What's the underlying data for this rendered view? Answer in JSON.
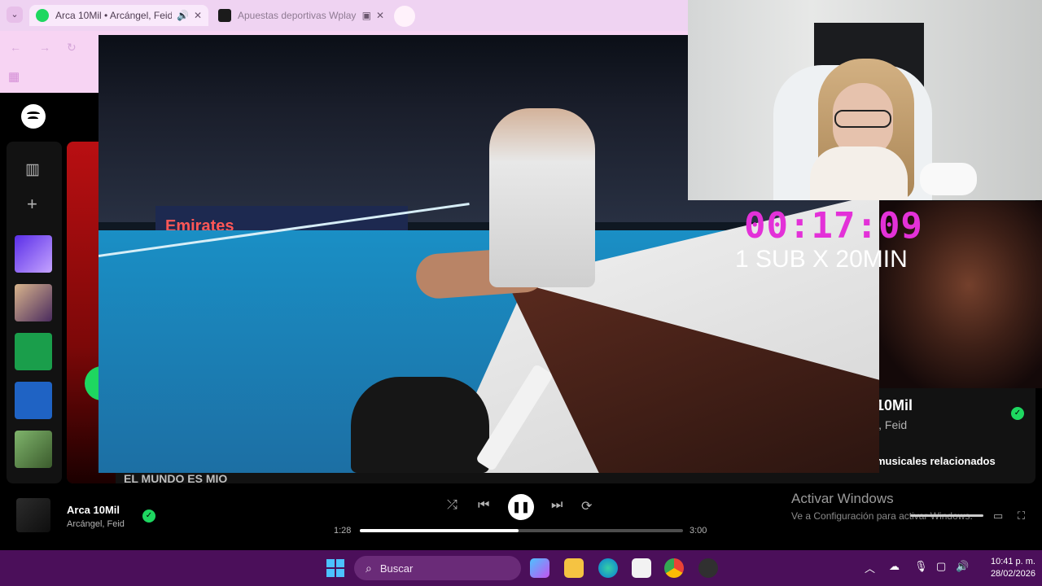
{
  "browser": {
    "tabs": [
      {
        "label": "Arca 10Mil • Arcángel, Feid",
        "audio_icon": "speaker-icon",
        "close": "✕"
      },
      {
        "label": "Apuestas deportivas Wplay",
        "pip_icon": "picture-in-picture-icon",
        "close": "✕"
      }
    ],
    "nav": {
      "back": "←",
      "forward": "→",
      "reload": "↻"
    }
  },
  "spotify": {
    "section_heading": "EL MUNDO ES MIO",
    "right_panel": {
      "title": "10Mil",
      "artist": "l, Feid",
      "related": "musicales relacionados"
    },
    "now_playing": {
      "title": "Arca 10Mil",
      "artist": "Arcángel, Feid",
      "elapsed": "1:28",
      "duration": "3:00",
      "progress": 0.49
    },
    "controls": {
      "shuffle": "⤮",
      "prev": "⏮",
      "pause": "❚❚",
      "next": "⏭",
      "repeat": "⟳"
    }
  },
  "overlay": {
    "timer": "00:17:09",
    "promo": "1 SUB X 20MIN",
    "sponsor": "Emirates"
  },
  "windows_notice": {
    "title": "Activar Windows",
    "subtitle": "Ve a Configuración para activar Windows."
  },
  "taskbar": {
    "search_placeholder": "Buscar",
    "time": "10:41 p. m.",
    "date": "28/02/2026"
  },
  "colors": {
    "spotify_green": "#1ed760",
    "timer_magenta": "#e331d8",
    "taskbar": "#4b0f5a"
  }
}
